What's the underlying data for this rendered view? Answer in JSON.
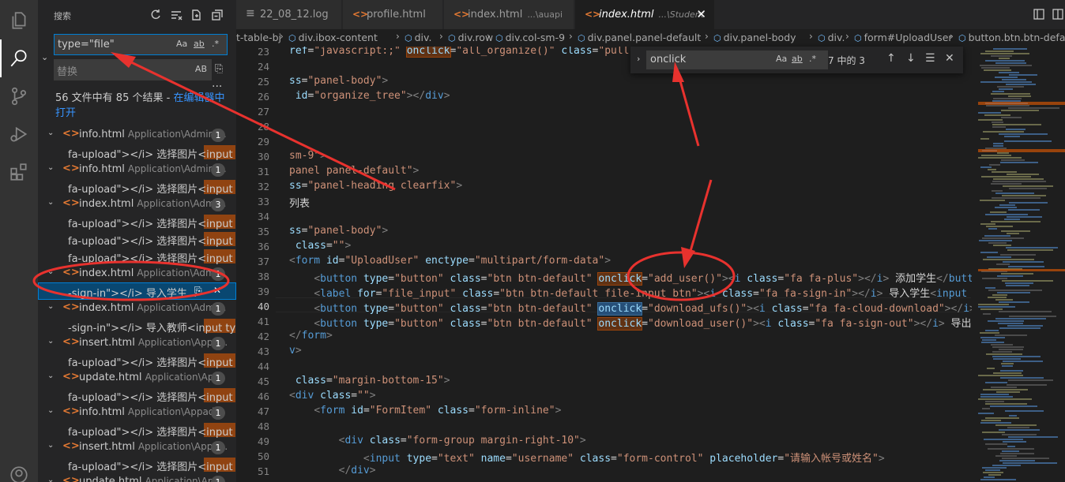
{
  "sidebar": {
    "title": "搜索",
    "search_value": "type=\"file\"",
    "search_options": [
      "Aa",
      "ab",
      ".*"
    ],
    "replace_placeholder": "替换",
    "replace_option": "AB",
    "more": "...",
    "summary_prefix": "56 文件中有 85 个结果 - ",
    "summary_link": "在编辑器中打开",
    "results": [
      {
        "kind": "file",
        "name": "info.html",
        "path": "Application\\Admin\\...",
        "count": "1"
      },
      {
        "kind": "match",
        "text": "fa-upload\"></i> 选择图片<input t..."
      },
      {
        "kind": "file",
        "name": "info.html",
        "path": "Application\\Admin\\...",
        "count": "1"
      },
      {
        "kind": "match",
        "text": "fa-upload\"></i> 选择图片<input t..."
      },
      {
        "kind": "file",
        "name": "index.html",
        "path": "Application\\Admi...",
        "count": "3"
      },
      {
        "kind": "match",
        "text": "fa-upload\"></i> 选择图片<input t..."
      },
      {
        "kind": "match",
        "text": "fa-upload\"></i> 选择图片<input t..."
      },
      {
        "kind": "match",
        "text": "fa-upload\"></i> 选择图片<input t..."
      },
      {
        "kind": "file",
        "name": "index.html",
        "path": "Application\\Admi...",
        "count": "1"
      },
      {
        "kind": "match",
        "text": "-sign-in\"></i> 导入学生...",
        "selected": true
      },
      {
        "kind": "file",
        "name": "index.html",
        "path": "Application\\Admi...",
        "count": "1"
      },
      {
        "kind": "match",
        "text": "-sign-in\"></i> 导入教师<input typ..."
      },
      {
        "kind": "file",
        "name": "insert.html",
        "path": "Application\\Appa...",
        "count": "1"
      },
      {
        "kind": "match",
        "text": "fa-upload\"></i> 选择图片<input t..."
      },
      {
        "kind": "file",
        "name": "update.html",
        "path": "Application\\Ap...",
        "count": "1"
      },
      {
        "kind": "match",
        "text": "fa-upload\"></i> 选择图片<input t..."
      },
      {
        "kind": "file",
        "name": "info.html",
        "path": "Application\\Appad...",
        "count": "1"
      },
      {
        "kind": "match",
        "text": "fa-upload\"></i> 选择图片<input t..."
      },
      {
        "kind": "file",
        "name": "insert.html",
        "path": "Application\\Appa...",
        "count": "1"
      },
      {
        "kind": "match",
        "text": "fa-upload\"></i> 选择图片<input t..."
      },
      {
        "kind": "file",
        "name": "update.html",
        "path": "Application\\Ap...",
        "count": "1"
      }
    ]
  },
  "tabs": [
    {
      "name": "22_08_12.log",
      "path": "",
      "icon": "log"
    },
    {
      "name": "profile.html",
      "path": "",
      "icon": "html"
    },
    {
      "name": "index.html",
      "path": "...\\auapi",
      "icon": "html"
    },
    {
      "name": "index.html",
      "path": "...\\Student",
      "icon": "html",
      "active": true
    }
  ],
  "breadcrumb": [
    "t-table-bj",
    "div.ibox-content",
    "div.",
    "div.row",
    "div.col-sm-9",
    "div.panel.panel-default",
    "div.panel-body",
    "div.",
    "form#UploadUser",
    "button.btn.btn-default"
  ],
  "find_widget": {
    "value": "onclick",
    "options": [
      "Aa",
      "ab",
      ".*"
    ],
    "count": "7 中的 3"
  },
  "editor": {
    "current_line": "40",
    "line_numbers": [
      "23",
      "24",
      "25",
      "26",
      "27",
      "28",
      "29",
      "30",
      "31",
      "32",
      "33",
      "34",
      "35",
      "36",
      "37",
      "38",
      "39",
      "40",
      "41",
      "42",
      "43",
      "44",
      "45",
      "46",
      "47",
      "48",
      "49",
      "50",
      "51"
    ]
  }
}
